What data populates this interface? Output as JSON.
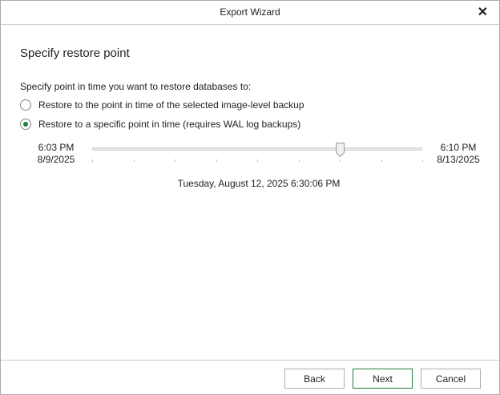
{
  "window": {
    "title": "Export Wizard",
    "close_icon": "close-icon"
  },
  "page": {
    "heading": "Specify restore point",
    "prompt": "Specify point in time you want to restore databases to:"
  },
  "options": [
    {
      "label": "Restore to the point in time of the selected image-level backup",
      "selected": false
    },
    {
      "label": "Restore to a specific point in time (requires WAL log backups)",
      "selected": true
    }
  ],
  "slider": {
    "start_time": "6:03 PM",
    "start_date": "8/9/2025",
    "end_time": "6:10 PM",
    "end_date": "8/13/2025",
    "position_fraction": 0.75,
    "tick_count": 9,
    "selected_value": "Tuesday, August 12, 2025 6:30:06 PM"
  },
  "buttons": {
    "back": "Back",
    "next": "Next",
    "cancel": "Cancel"
  },
  "colors": {
    "accent": "#1e7e3e"
  }
}
